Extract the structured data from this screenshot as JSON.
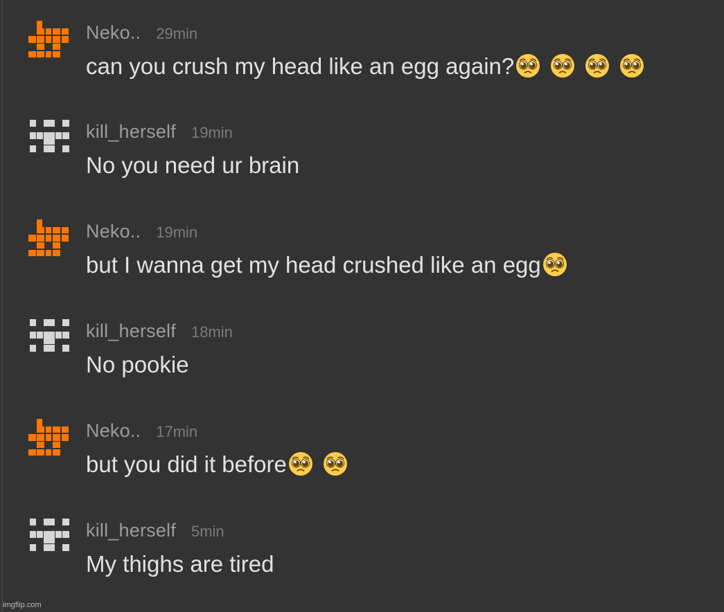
{
  "colors": {
    "background": "#333333",
    "username": "#9c9c9c",
    "timestamp": "#7c7c7c",
    "message_text": "#e2e2e2",
    "avatar_orange": "#ff7700",
    "avatar_white": "#d6d6d6"
  },
  "messages": [
    {
      "username": "Neko..",
      "time": "29min",
      "text": "can you crush my head like an egg again?",
      "avatar": "orange-pixel-avatar",
      "emoji": "pleading-face-emoji",
      "emoji_count": 4
    },
    {
      "username": "kill_herself",
      "time": "19min",
      "text": "No you need ur brain",
      "avatar": "white-pixel-avatar",
      "emoji": "",
      "emoji_count": 0
    },
    {
      "username": "Neko..",
      "time": "19min",
      "text": "but I wanna get my head crushed like an egg",
      "avatar": "orange-pixel-avatar",
      "emoji": "pleading-face-emoji",
      "emoji_count": 1
    },
    {
      "username": "kill_herself",
      "time": "18min",
      "text": "No pookie",
      "avatar": "white-pixel-avatar",
      "emoji": "",
      "emoji_count": 0
    },
    {
      "username": "Neko..",
      "time": "17min",
      "text": "but you did it before",
      "avatar": "orange-pixel-avatar",
      "emoji": "pleading-face-emoji",
      "emoji_count": 2
    },
    {
      "username": "kill_herself",
      "time": "5min",
      "text": "My thighs are tired",
      "avatar": "white-pixel-avatar",
      "emoji": "",
      "emoji_count": 0
    }
  ],
  "watermark": "imgflip.com"
}
